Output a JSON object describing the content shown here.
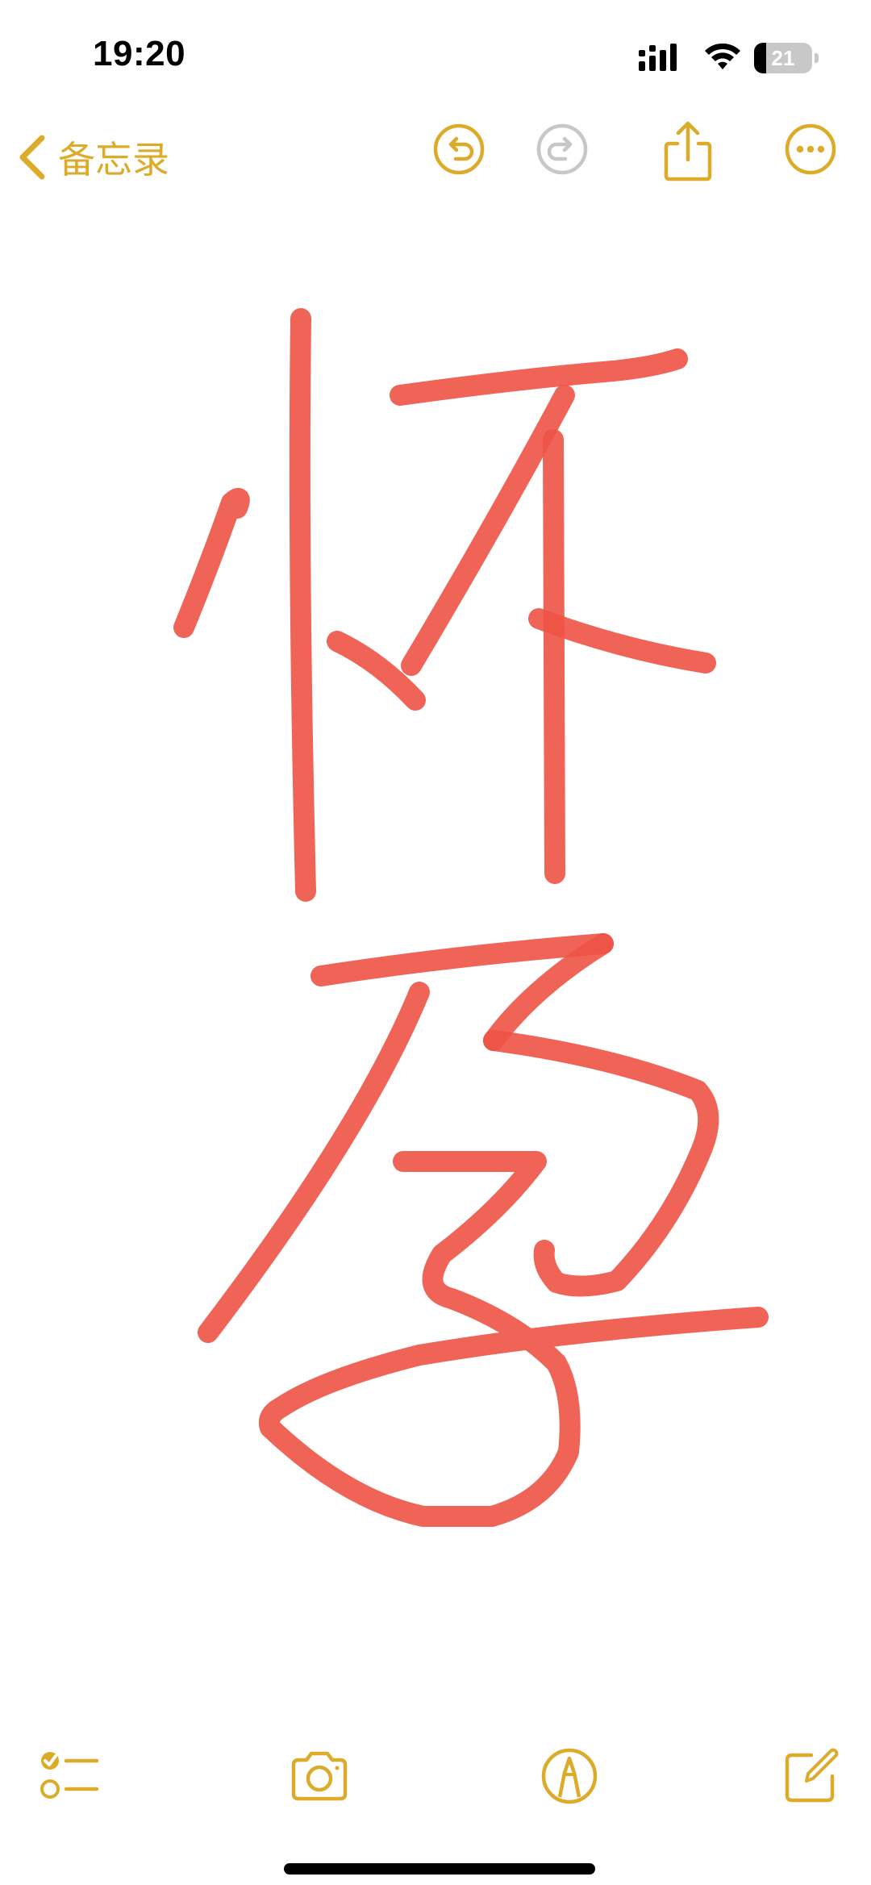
{
  "status_bar": {
    "time": "19:20",
    "battery_level": "21",
    "battery_fraction": 0.21,
    "icons": [
      "signal-icon",
      "wifi-icon",
      "battery-icon"
    ]
  },
  "nav": {
    "back_label": "备忘录",
    "icons": [
      "chevron-left-icon",
      "undo-icon",
      "redo-icon",
      "share-icon",
      "more-icon"
    ],
    "redo_enabled": false
  },
  "drawing": {
    "stroke_color": "#ee5345",
    "content": "handwritten-characters"
  },
  "toolbar": {
    "icons": [
      "checklist-icon",
      "camera-icon",
      "markup-icon",
      "compose-icon"
    ]
  },
  "colors": {
    "accent": "#dcab2a",
    "disabled": "#c7c7c7",
    "ink": "#ee5345"
  }
}
